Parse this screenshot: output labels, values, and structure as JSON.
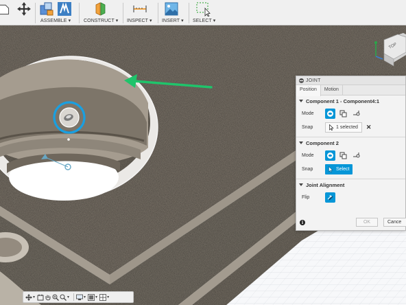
{
  "toolbar": {
    "groups": [
      {
        "label": "ASSEMBLE",
        "icon": "assemble-icon"
      },
      {
        "label": "CONSTRUCT",
        "icon": "construct-icon"
      },
      {
        "label": "INSPECT",
        "icon": "measure-icon"
      },
      {
        "label": "INSERT",
        "icon": "insert-image-icon"
      },
      {
        "label": "SELECT",
        "icon": "select-window-icon"
      }
    ],
    "dropdown_glyph": "▾"
  },
  "viewcube": {
    "face_label": "TOP"
  },
  "joint_panel": {
    "title": "JOINT",
    "tabs": [
      "Position",
      "Motion"
    ],
    "component1": {
      "title": "Component 1 - Component4:1",
      "mode_label": "Mode",
      "snap_label": "Snap",
      "snap_value": "1 selected",
      "clear_glyph": "✕"
    },
    "component2": {
      "title": "Component 2",
      "mode_label": "Mode",
      "snap_label": "Snap",
      "select_label": "Select"
    },
    "alignment": {
      "title": "Joint Alignment",
      "flip_label": "Flip"
    },
    "info_glyph": "i",
    "ok_label": "OK",
    "cancel_label": "Cance"
  },
  "colors": {
    "accent": "#0696d7",
    "annotation_arrow": "#1fc46b",
    "surface": "#8c8377",
    "toolbar_bg": "#f0f0f0"
  }
}
